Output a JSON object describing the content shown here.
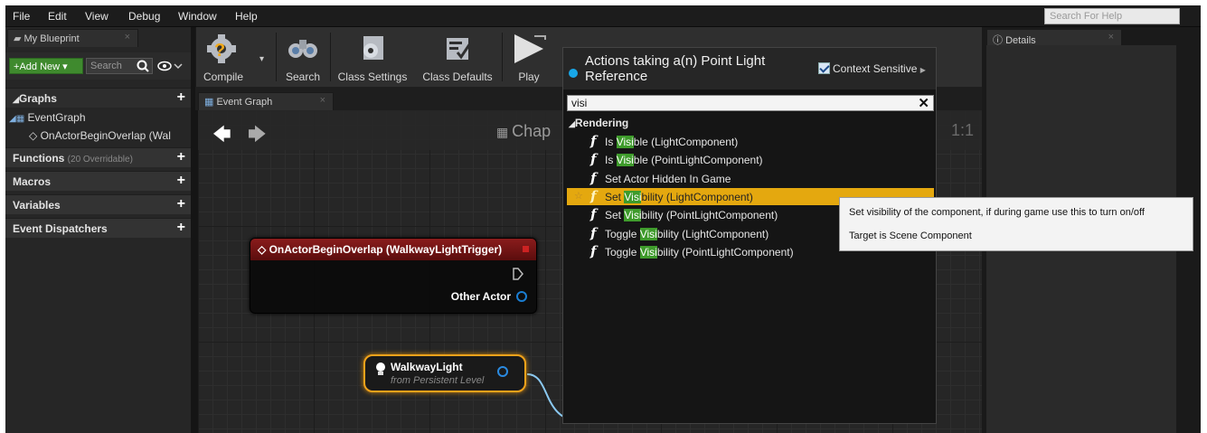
{
  "menu": [
    "File",
    "Edit",
    "View",
    "Debug",
    "Window",
    "Help"
  ],
  "help_search_placeholder": "Search For Help",
  "left_panel": {
    "tab_label": "My Blueprint",
    "add_new_label": "Add New",
    "search_placeholder": "Search",
    "sections": {
      "graphs": "Graphs",
      "event_graph": "EventGraph",
      "event_item": "OnActorBeginOverlap (Wal",
      "functions": "Functions",
      "functions_sub": "(20 Overridable)",
      "macros": "Macros",
      "variables": "Variables",
      "event_dispatchers": "Event Dispatchers"
    }
  },
  "toolbar": {
    "compile": "Compile",
    "search": "Search",
    "class_settings": "Class Settings",
    "class_defaults": "Class Defaults",
    "play": "Play"
  },
  "graph": {
    "tab_label": "Event Graph",
    "title": "Chap",
    "zoom": "1:1",
    "event_node": {
      "title": "OnActorBeginOverlap (WalkwayLightTrigger)",
      "pin_label": "Other Actor"
    },
    "light_node": {
      "title": "WalkwayLight",
      "subtitle": "from Persistent Level"
    }
  },
  "details": {
    "tab_label": "Details"
  },
  "action_menu": {
    "title": "Actions taking a(n) Point Light Reference",
    "context_label": "Context Sensitive",
    "context_checked": true,
    "search_value": "visi",
    "category": "Rendering",
    "items": [
      {
        "pre": "Is ",
        "hl": "Visi",
        "post": "ble (LightComponent)",
        "icon": "function-icon"
      },
      {
        "pre": "Is ",
        "hl": "Visi",
        "post": "ble (PointLightComponent)",
        "icon": "function-icon"
      },
      {
        "pre": "Set Actor Hidden In Game",
        "hl": "",
        "post": "",
        "icon": "function-icon"
      },
      {
        "pre": "Set ",
        "hl": "Visi",
        "post": "bility (LightComponent)",
        "icon": "function-icon",
        "selected": true
      },
      {
        "pre": "Set ",
        "hl": "Visi",
        "post": "bility (PointLightComponent)",
        "icon": "function-icon"
      },
      {
        "pre": "Toggle ",
        "hl": "Visi",
        "post": "bility (LightComponent)",
        "icon": "function-icon"
      },
      {
        "pre": "Toggle ",
        "hl": "Visi",
        "post": "bility (PointLightComponent)",
        "icon": "function-icon"
      }
    ]
  },
  "tooltip": {
    "line1": "Set visibility of the component, if during game use this to turn on/off",
    "line2": "Target is Scene Component"
  },
  "colors": {
    "accent_green": "#3e9b2b",
    "selection_orange": "#e4a80f",
    "event_red": "#8a1c1c",
    "pin_blue": "#1a7dd1"
  }
}
